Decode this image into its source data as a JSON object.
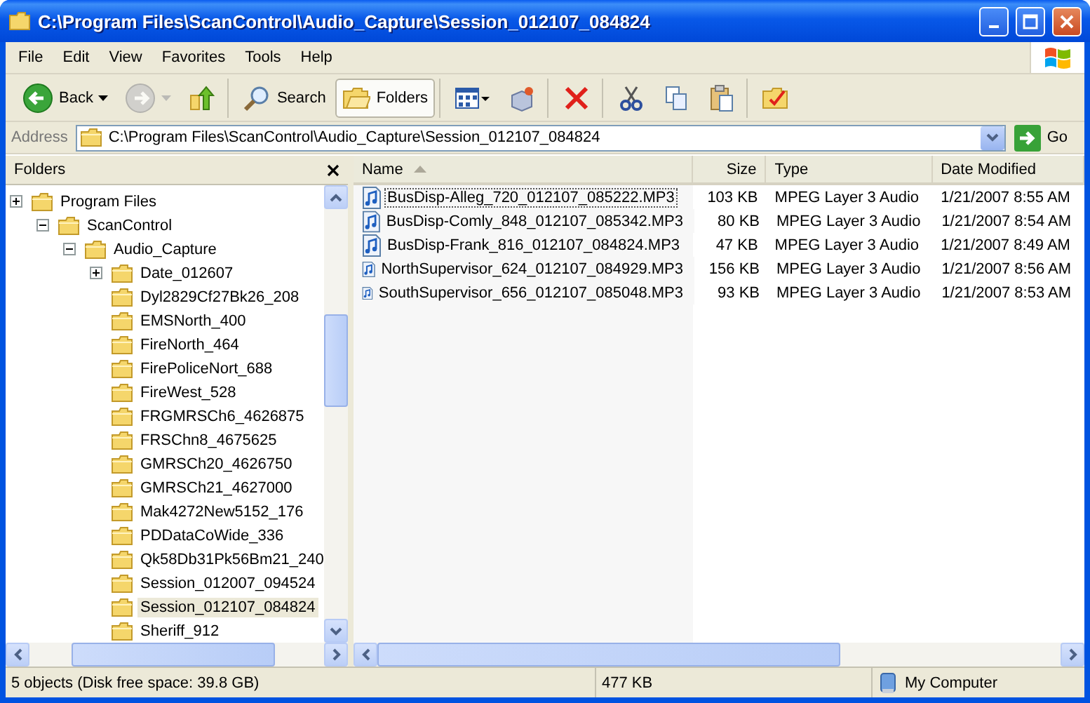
{
  "window": {
    "title": "C:\\Program Files\\ScanControl\\Audio_Capture\\Session_012107_084824"
  },
  "menu": [
    {
      "label": "File"
    },
    {
      "label": "Edit"
    },
    {
      "label": "View"
    },
    {
      "label": "Favorites"
    },
    {
      "label": "Tools"
    },
    {
      "label": "Help"
    }
  ],
  "toolbar": {
    "groups": [
      [
        {
          "kind": "back",
          "label": "Back",
          "disabled": false,
          "selected": false
        },
        {
          "kind": "forward",
          "disabled": true,
          "selected": false
        },
        {
          "kind": "up",
          "disabled": false,
          "selected": false
        }
      ],
      [
        {
          "kind": "search",
          "label": "Search",
          "disabled": false,
          "selected": false
        },
        {
          "kind": "folders",
          "label": "Folders",
          "disabled": false,
          "selected": true
        }
      ],
      [
        {
          "kind": "views",
          "disabled": false,
          "selected": false
        },
        {
          "kind": "move",
          "disabled": false,
          "selected": false
        }
      ],
      [
        {
          "kind": "delete",
          "disabled": false,
          "selected": false
        }
      ],
      [
        {
          "kind": "cut",
          "disabled": false,
          "selected": false
        },
        {
          "kind": "copy",
          "disabled": false,
          "selected": false
        },
        {
          "kind": "paste",
          "disabled": false,
          "selected": false
        }
      ],
      [
        {
          "kind": "undo",
          "disabled": false,
          "selected": false
        }
      ]
    ]
  },
  "address": {
    "label": "Address",
    "value": "C:\\Program Files\\ScanControl\\Audio_Capture\\Session_012107_084824",
    "go": "Go"
  },
  "folders_pane": {
    "title": "Folders",
    "tree": [
      {
        "label": "Program Files",
        "expanded": false,
        "selected": false,
        "children": [
          {
            "label": "ScanControl",
            "expanded": true,
            "selected": false,
            "children": [
              {
                "label": "Audio_Capture",
                "expanded": true,
                "selected": false,
                "children": [
                  {
                    "label": "Date_012607",
                    "expanded": false,
                    "selected": false
                  },
                  {
                    "label": "Dyl2829Cf27Bk26_208",
                    "selected": false
                  },
                  {
                    "label": "EMSNorth_400",
                    "selected": false
                  },
                  {
                    "label": "FireNorth_464",
                    "selected": false
                  },
                  {
                    "label": "FirePoliceNort_688",
                    "selected": false
                  },
                  {
                    "label": "FireWest_528",
                    "selected": false
                  },
                  {
                    "label": "FRGMRSCh6_4626875",
                    "selected": false
                  },
                  {
                    "label": "FRSChn8_4675625",
                    "selected": false
                  },
                  {
                    "label": "GMRSCh20_4626750",
                    "selected": false
                  },
                  {
                    "label": "GMRSCh21_4627000",
                    "selected": false
                  },
                  {
                    "label": "Mak4272New5152_176",
                    "selected": false
                  },
                  {
                    "label": "PDDataCoWide_336",
                    "selected": false
                  },
                  {
                    "label": "Qk58Db31Pk56Bm21_240",
                    "selected": false
                  },
                  {
                    "label": "Session_012007_094524",
                    "selected": false
                  },
                  {
                    "label": "Session_012107_084824",
                    "selected": true
                  },
                  {
                    "label": "Sheriff_912",
                    "selected": false
                  }
                ]
              }
            ]
          }
        ]
      }
    ]
  },
  "files": {
    "columns": [
      {
        "label": "Name",
        "sorted": true
      },
      {
        "label": "Size",
        "sorted": false
      },
      {
        "label": "Type",
        "sorted": false
      },
      {
        "label": "Date Modified",
        "sorted": false
      }
    ],
    "rows": [
      {
        "name": "BusDisp-Alleg_720_012107_085222.MP3",
        "size": "103 KB",
        "type": "MPEG Layer 3 Audio",
        "modified": "1/21/2007 8:55 AM",
        "focused": true
      },
      {
        "name": "BusDisp-Comly_848_012107_085342.MP3",
        "size": "80 KB",
        "type": "MPEG Layer 3 Audio",
        "modified": "1/21/2007 8:54 AM",
        "focused": false
      },
      {
        "name": "BusDisp-Frank_816_012107_084824.MP3",
        "size": "47 KB",
        "type": "MPEG Layer 3 Audio",
        "modified": "1/21/2007 8:49 AM",
        "focused": false
      },
      {
        "name": "NorthSupervisor_624_012107_084929.MP3",
        "size": "156 KB",
        "type": "MPEG Layer 3 Audio",
        "modified": "1/21/2007 8:56 AM",
        "focused": false
      },
      {
        "name": "SouthSupervisor_656_012107_085048.MP3",
        "size": "93 KB",
        "type": "MPEG Layer 3 Audio",
        "modified": "1/21/2007 8:53 AM",
        "focused": false
      }
    ]
  },
  "status_bar": {
    "objects": "5 objects (Disk free space: 39.8 GB)",
    "size": "477 KB",
    "zone": "My Computer"
  }
}
